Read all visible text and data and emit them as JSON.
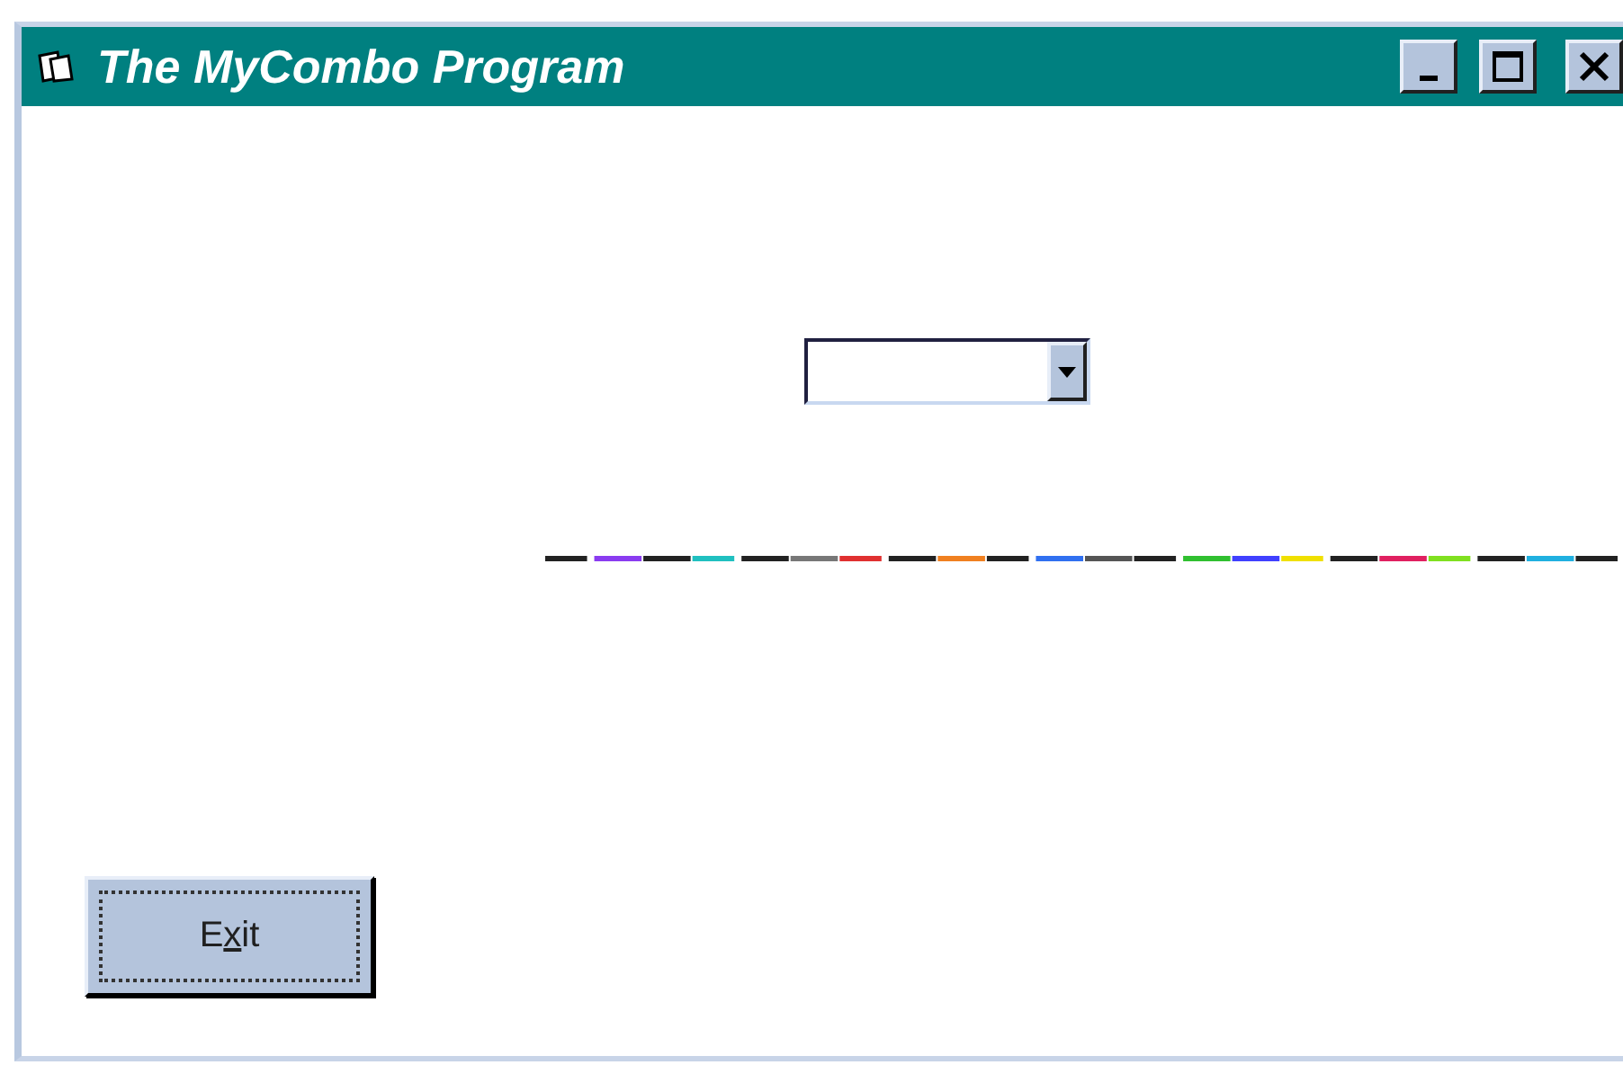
{
  "window": {
    "title": "The MyCombo Program"
  },
  "exit_button": {
    "label_before": "E",
    "access_key": "x",
    "label_after": "it",
    "focused": true
  }
}
